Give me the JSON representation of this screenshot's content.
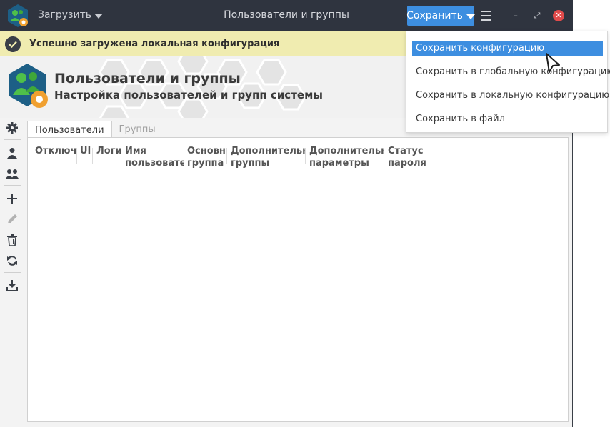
{
  "window": {
    "title": "Пользователи и группы",
    "load_label": "Загрузить",
    "save_label": "Сохранить",
    "minimize_glyph": "–",
    "maximize_glyph": "⤢",
    "close_glyph": "✕"
  },
  "notification": {
    "text": "Успешно загружена локальная конфигурация",
    "icon": "check-circle-icon"
  },
  "header": {
    "title": "Пользователи и группы",
    "subtitle": "Настройка пользователей и групп системы"
  },
  "toolbar": [
    {
      "name": "settings",
      "icon": "gear-icon",
      "enabled": true
    },
    {
      "name": "users",
      "icon": "user-icon",
      "enabled": true
    },
    {
      "name": "groups",
      "icon": "group-icon",
      "enabled": true
    },
    {
      "name": "add",
      "icon": "plus-icon",
      "enabled": true
    },
    {
      "name": "edit",
      "icon": "pencil-icon",
      "enabled": false
    },
    {
      "name": "delete",
      "icon": "trash-icon",
      "enabled": true
    },
    {
      "name": "refresh",
      "icon": "refresh-icon",
      "enabled": true
    },
    {
      "name": "download",
      "icon": "download-icon",
      "enabled": true
    }
  ],
  "tabs": [
    {
      "label": "Пользователи",
      "active": true
    },
    {
      "label": "Группы",
      "active": false
    }
  ],
  "table": {
    "columns": [
      {
        "line1": "Отключен",
        "line2": ""
      },
      {
        "line1": "UID",
        "line2": ""
      },
      {
        "line1": "Логин",
        "line2": ""
      },
      {
        "line1": "Имя",
        "line2": "пользователя"
      },
      {
        "line1": "Основная",
        "line2": "группа"
      },
      {
        "line1": "Дополнительные",
        "line2": "группы"
      },
      {
        "line1": "Дополнительные",
        "line2": "параметры"
      },
      {
        "line1": "Статус",
        "line2": "пароля"
      }
    ],
    "rows": []
  },
  "save_menu": {
    "items": [
      {
        "label": "Сохранить конфигурацию",
        "highlighted": true
      },
      {
        "label": "Сохранить в глобальную конфигурацию",
        "highlighted": false
      },
      {
        "label": "Сохранить в локальную конфигурацию",
        "highlighted": false
      },
      {
        "label": "Сохранить в файл",
        "highlighted": false
      }
    ]
  },
  "colors": {
    "titlebar": "#2f343f",
    "accent": "#3d8ee0",
    "notification_bg": "#f0ecb0",
    "close": "#e14b4b"
  }
}
